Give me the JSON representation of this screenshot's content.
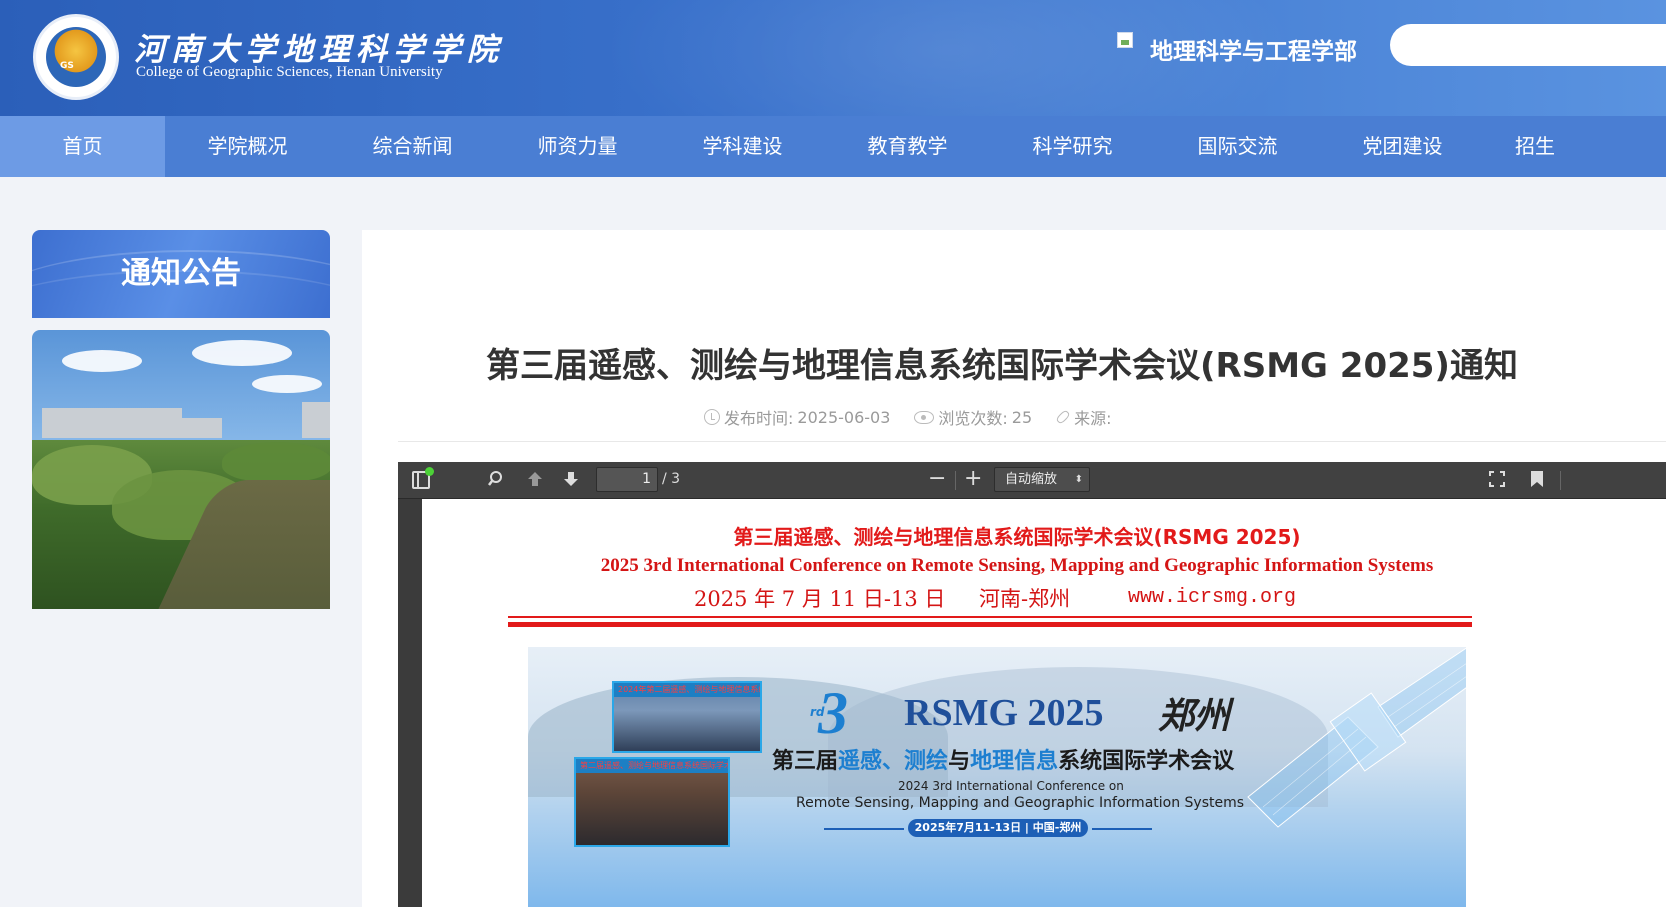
{
  "header": {
    "logo_text": "GS",
    "site_name_cn": "河南大学地理科学学院",
    "site_name_en": "College of Geographic Sciences, Henan University",
    "dept_link": "地理科学与工程学部",
    "search_placeholder": ""
  },
  "nav": {
    "items": [
      {
        "label": "首页",
        "active": true
      },
      {
        "label": "学院概况"
      },
      {
        "label": "综合新闻"
      },
      {
        "label": "师资力量"
      },
      {
        "label": "学科建设"
      },
      {
        "label": "教育教学"
      },
      {
        "label": "科学研究"
      },
      {
        "label": "国际交流"
      },
      {
        "label": "党团建设"
      },
      {
        "label": "招生"
      }
    ]
  },
  "sidebar": {
    "title": "通知公告"
  },
  "article": {
    "title": "第三届遥感、测绘与地理信息系统国际学术会议(RSMG 2025)通知",
    "publish_label": "发布时间:",
    "publish_date": "2025-06-03",
    "views_label": "浏览次数:",
    "views": "25",
    "source_label": "来源:"
  },
  "pdf_viewer": {
    "page_current": "1",
    "page_total": "/ 3",
    "zoom_value": "自动缩放",
    "doc": {
      "title_cn": "第三届遥感、测绘与地理信息系统国际学术会议(RSMG 2025)",
      "title_en": "2025 3rd International Conference on Remote Sensing, Mapping and Geographic Information Systems",
      "date": "2025 年 7 月 11 日-13 日",
      "place": "河南-郑州",
      "url": "www.icrsmg.org"
    },
    "banner": {
      "ordinal": "3",
      "ordinal_suffix": "rd",
      "acronym": "RSMG 2025",
      "city_script": "郑州",
      "name_cn_part1": "第三届",
      "name_cn_hl1": "遥感",
      "name_cn_sep": "、",
      "name_cn_hl2": "测绘",
      "name_cn_part2": "与",
      "name_cn_hl3": "地理信息",
      "name_cn_part3": "系统国际学术会议",
      "name_en_line1": "2024 3rd International Conference on",
      "name_en_line2": "Remote Sensing, Mapping and Geographic Information Systems",
      "date_pill": "2025年7月11-13日 | 中国-郑州",
      "photo1_caption": "2024年第二届遥感、测绘与地理信息系统国际学术会议",
      "photo2_caption": "第二届遥感、测绘与地理信息系统国际学术会议(RSMG"
    }
  }
}
